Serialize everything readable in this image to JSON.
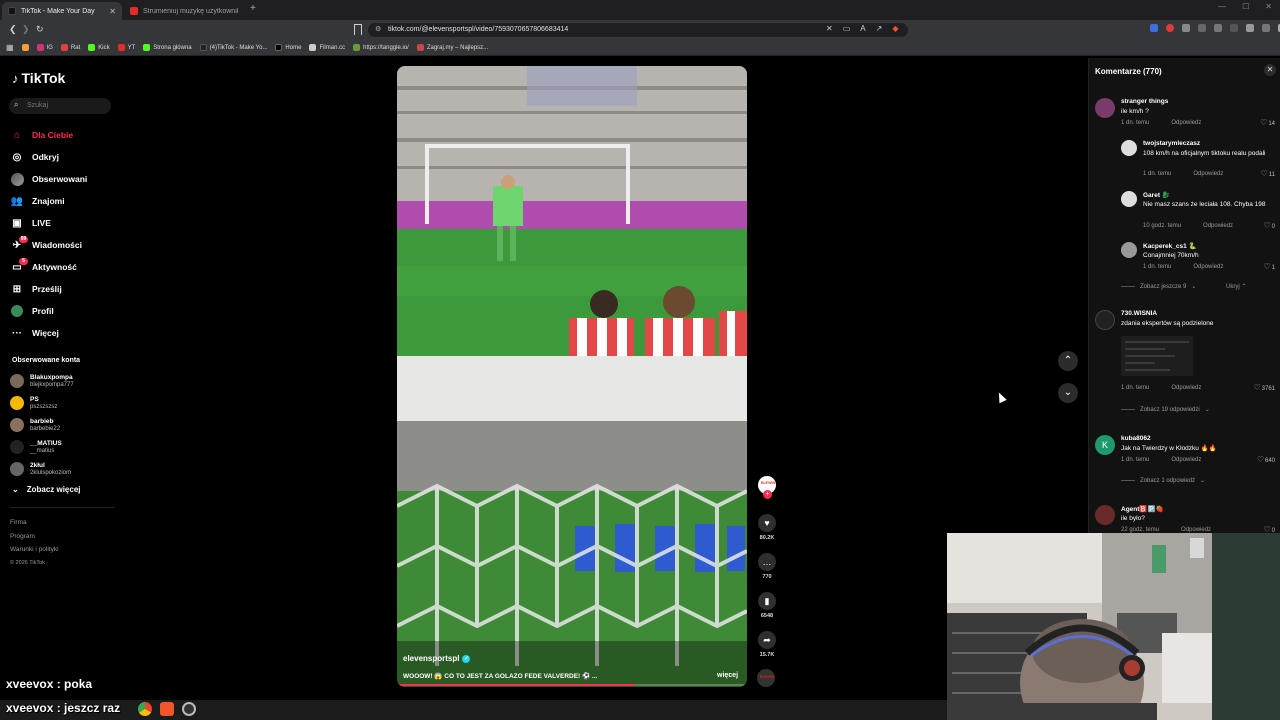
{
  "browser": {
    "tabs": [
      {
        "title": "TikTok - Make Your Day",
        "active": true
      },
      {
        "title": "Strumieniuj muzykę użytkownika ni...",
        "active": false
      }
    ],
    "url": "tiktok.com/@elevensportspl/video/7593070657806683414",
    "bookmarks": [
      "IG",
      "Rat",
      "Kick",
      "YT",
      "Strona główna",
      "(4)TikTok - Make Yo...",
      "Home",
      "Filman.cc",
      "https://tanggle.io/",
      "Zagraj.my – Najlepsz..."
    ]
  },
  "sidebar": {
    "logo": "TikTok",
    "search_placeholder": "Szukaj",
    "nav": [
      {
        "label": "Dla Ciebie",
        "icon": "home-icon",
        "active": true
      },
      {
        "label": "Odkryj",
        "icon": "compass-icon"
      },
      {
        "label": "Obserwowani",
        "icon": "following-icon"
      },
      {
        "label": "Znajomi",
        "icon": "friends-icon"
      },
      {
        "label": "LIVE",
        "icon": "live-icon"
      },
      {
        "label": "Wiadomości",
        "icon": "message-icon",
        "badge": "99"
      },
      {
        "label": "Aktywność",
        "icon": "activity-icon",
        "badge": "5"
      },
      {
        "label": "Prześlij",
        "icon": "upload-icon"
      },
      {
        "label": "Profil",
        "icon": "profile-icon"
      },
      {
        "label": "Więcej",
        "icon": "more-icon"
      }
    ],
    "followed_title": "Obserwowane konta",
    "followed": [
      {
        "name": "Blakuxpompa",
        "handle": "blejkxpompa777"
      },
      {
        "name": "PS",
        "handle": "pszszszsz"
      },
      {
        "name": "barbieb",
        "handle": "barbebie22"
      },
      {
        "name": "__MATIUS",
        "handle": "__matius"
      },
      {
        "name": "2kłul",
        "handle": "2klulspokoziom"
      }
    ],
    "see_more": "Zobacz więcej",
    "footer": [
      "Firma",
      "Program",
      "Warunki i polityki"
    ],
    "copyright": "© 2026 TikTok"
  },
  "video": {
    "username": "elevensportspl",
    "caption": "WOOOW! 😱 CO TO JEST ZA GOLAZO FEDE VALVERDE! ⚽ ...",
    "more_label": "więcej",
    "progress": 0.68,
    "likes": "80.2K",
    "comments": "770",
    "saves": "6548",
    "shares": "15.7K",
    "creator_badge": "ELEVEN"
  },
  "comments_panel": {
    "title": "Komentarze (770)",
    "items": [
      {
        "user": "stranger things",
        "text": "ile km/h ?",
        "time": "1 dn. temu",
        "reply": "Odpowiedz",
        "likes": "14"
      },
      {
        "user": "twojstarymleczasz",
        "text": "108 km/h na oficjalnym tiktoku realu podali",
        "time": "1 dn. temu",
        "reply": "Odpowiedz",
        "likes": "11"
      },
      {
        "user": "Garet 🐉",
        "text": "Nie masz szans że leciała 108. Chyba 198",
        "time": "10 godz. temu",
        "reply": "Odpowiedz",
        "likes": "0"
      },
      {
        "user": "Kacperek_cs1 🐍",
        "text": "Conajmniej 70km/h",
        "time": "1 dn. temu",
        "reply": "Odpowiedz",
        "likes": "1"
      },
      {
        "user": "730.WISNIA",
        "text": "zdania ekspertów są podzielone",
        "time": "1 dn. temu",
        "reply": "Odpowiedz",
        "likes": "3761"
      },
      {
        "user": "kuba8062",
        "text": "Jak na Twierdzy w Kłodzku 🔥🔥",
        "time": "1 dn. temu",
        "reply": "Odpowiedz",
        "likes": "640"
      },
      {
        "user": "Agent🅱️🅿️🍓",
        "text": "ile było?",
        "time": "22 godz. temu",
        "reply": "Odpowiedz",
        "likes": "0"
      }
    ],
    "more_replies_1": "Zobacz jeszcze 9",
    "hide_label": "Ukryj",
    "more_replies_2": "Zobacz 19 odpowiedzi",
    "more_replies_3": "Zobacz 1 odpowiedź",
    "k_initial": "K"
  },
  "chat": {
    "line1": "xveevox : poka",
    "line2": "xveevox : jeszcz raz"
  },
  "colors": {
    "accent": "#fe2c55",
    "panel": "#121212",
    "chrome": "#35363a"
  }
}
